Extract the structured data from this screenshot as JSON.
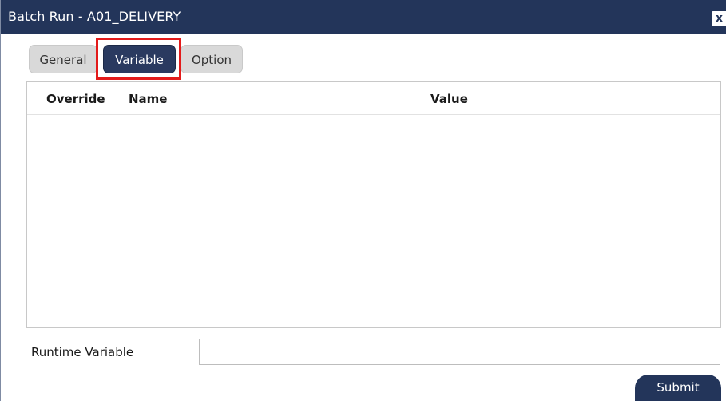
{
  "dialog": {
    "title": "Batch Run - A01_DELIVERY",
    "close_label": "x"
  },
  "tabs": [
    {
      "label": "General",
      "active": false
    },
    {
      "label": "Variable",
      "active": true
    },
    {
      "label": "Option",
      "active": false
    }
  ],
  "grid": {
    "columns": [
      "Override",
      "Name",
      "Value"
    ],
    "rows": []
  },
  "runtime": {
    "label": "Runtime Variable",
    "value": ""
  },
  "actions": {
    "submit_label": "Submit"
  },
  "colors": {
    "titlebar": "#23355a",
    "active_tab": "#2a3a60",
    "highlight_box": "#e31b1b",
    "inactive_tab": "#d9d9d9"
  }
}
